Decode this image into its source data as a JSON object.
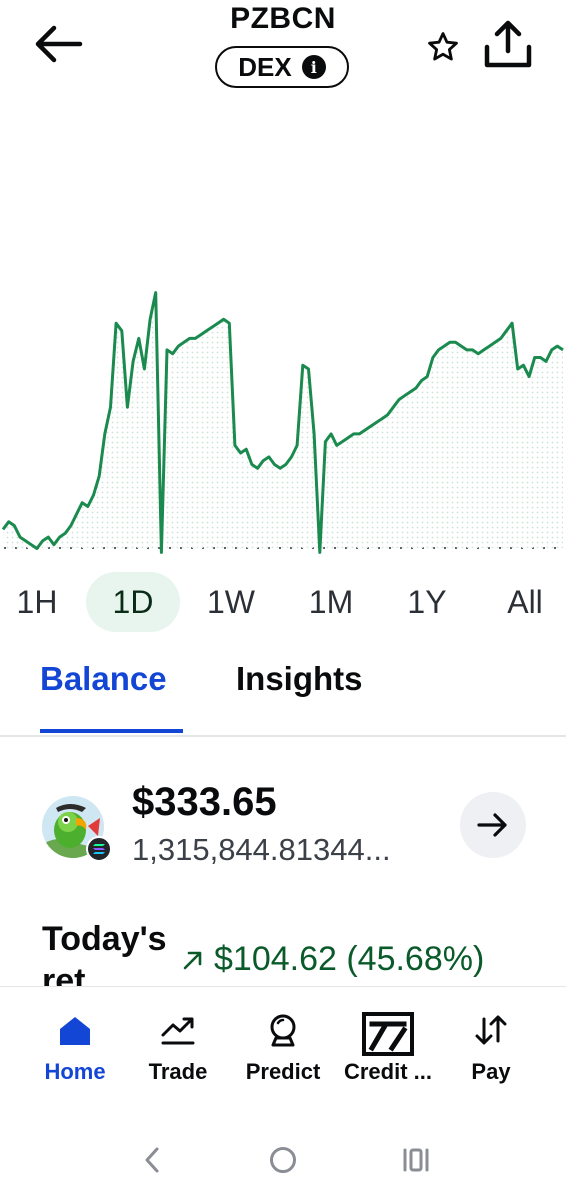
{
  "header": {
    "token_symbol": "PZBCN",
    "badge_label": "DEX"
  },
  "chart_data": {
    "type": "line",
    "timeframe": "1D",
    "x": [
      0,
      1,
      2,
      3,
      4,
      5,
      6,
      7,
      8,
      9,
      10,
      11,
      12,
      13,
      14,
      15,
      16,
      17,
      18,
      19,
      20,
      21,
      22,
      23,
      24,
      25,
      26,
      27,
      28,
      29,
      30,
      31,
      32,
      33,
      34,
      35,
      36,
      37,
      38,
      39,
      40,
      41,
      42,
      43,
      44,
      45,
      46,
      47,
      48,
      49,
      50,
      51,
      52,
      53,
      54,
      55,
      56,
      57,
      58,
      59,
      60,
      61,
      62,
      63,
      64,
      65,
      66,
      67,
      68,
      69,
      70,
      71,
      72,
      73,
      74,
      75,
      76,
      77,
      78,
      79,
      80,
      81,
      82,
      83,
      84,
      85,
      86,
      87,
      88,
      89,
      90,
      91,
      92,
      93,
      94,
      95,
      96,
      97,
      98,
      99
    ],
    "values": [
      8,
      10,
      9,
      6,
      5,
      4,
      3,
      5,
      6,
      4,
      6,
      7,
      9,
      12,
      15,
      14,
      17,
      22,
      33,
      40,
      62,
      60,
      40,
      52,
      58,
      50,
      63,
      70,
      2,
      55,
      54,
      56,
      57,
      58,
      58,
      59,
      60,
      61,
      62,
      63,
      62,
      30,
      28,
      29,
      25,
      24,
      26,
      27,
      25,
      24,
      25,
      27,
      30,
      51,
      50,
      33,
      2,
      31,
      33,
      30,
      31,
      32,
      33,
      33,
      34,
      35,
      36,
      37,
      38,
      40,
      42,
      43,
      44,
      45,
      47,
      48,
      53,
      55,
      56,
      57,
      57,
      56,
      55,
      55,
      54,
      55,
      56,
      57,
      58,
      60,
      62,
      50,
      51,
      48,
      53,
      53,
      52,
      55,
      56,
      55
    ],
    "ylim": [
      0,
      100
    ],
    "baseline_dotted": true,
    "color": "#1a8a4e"
  },
  "ranges": [
    "1H",
    "1D",
    "1W",
    "1M",
    "1Y",
    "All"
  ],
  "active_range": "1D",
  "tabs": {
    "balance": "Balance",
    "insights": "Insights"
  },
  "balance": {
    "value": "$333.65",
    "amount": "1,315,844.81344..."
  },
  "today_return": {
    "label": "Today's ret",
    "value": "$104.62 (45.68%)"
  },
  "nav": {
    "home": "Home",
    "trade": "Trade",
    "predict": "Predict",
    "credit": "Credit ...",
    "pay": "Pay"
  },
  "colors": {
    "accent": "#1446d6",
    "positive": "#1a8a4e"
  }
}
